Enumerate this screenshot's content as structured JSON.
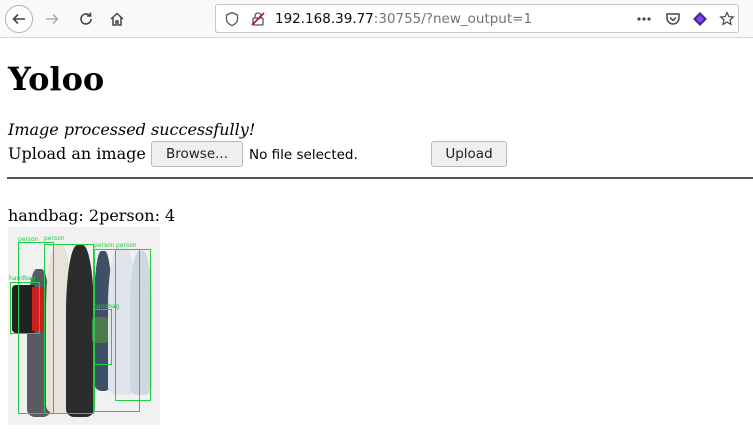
{
  "browser": {
    "url_host": "192.168.39.77",
    "url_rest": ":30755/?new_output=1",
    "icons": [
      "back-arrow-icon",
      "forward-arrow-icon",
      "reload-icon",
      "home-icon",
      "info-icon",
      "insecure-lock-icon",
      "more-dots-icon",
      "pocket-icon",
      "extension-icon",
      "bookmark-star-icon"
    ]
  },
  "page": {
    "title": "Yoloo",
    "status": "Image processed successfully!",
    "upload_label": "Upload an image",
    "browse_label": "Browse...",
    "no_file_text": "No file selected.",
    "upload_button": "Upload",
    "detection_counts": "handbag: 2person: 4"
  },
  "detection_image": {
    "labels": {
      "person_1": "person",
      "person_2": "person",
      "person_3": "person",
      "person_4": "person",
      "handbag_1": "handbag",
      "handbag_2": "handbag"
    },
    "box_color": "#22cc44"
  }
}
